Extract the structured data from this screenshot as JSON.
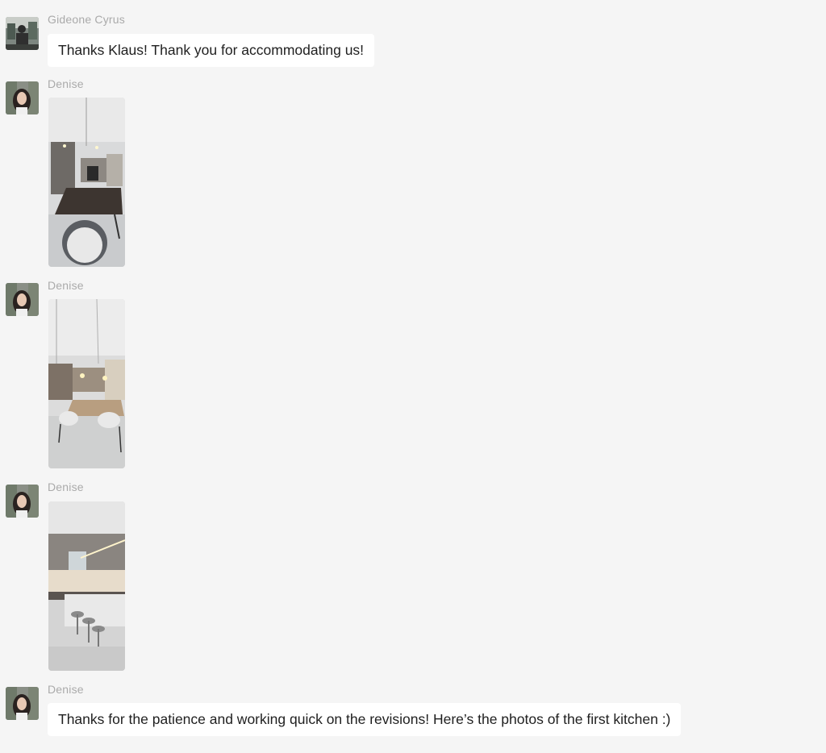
{
  "messages": [
    {
      "sender": "Gideone Cyrus",
      "type": "text",
      "text": "Thanks Klaus! Thank you for accommodating us!"
    },
    {
      "sender": "Denise",
      "type": "image"
    },
    {
      "sender": "Denise",
      "type": "image"
    },
    {
      "sender": "Denise",
      "type": "image"
    },
    {
      "sender": "Denise",
      "type": "text",
      "text": "Thanks for the patience and working quick on the revisions! Here’s the photos of the first kitchen :)"
    }
  ]
}
